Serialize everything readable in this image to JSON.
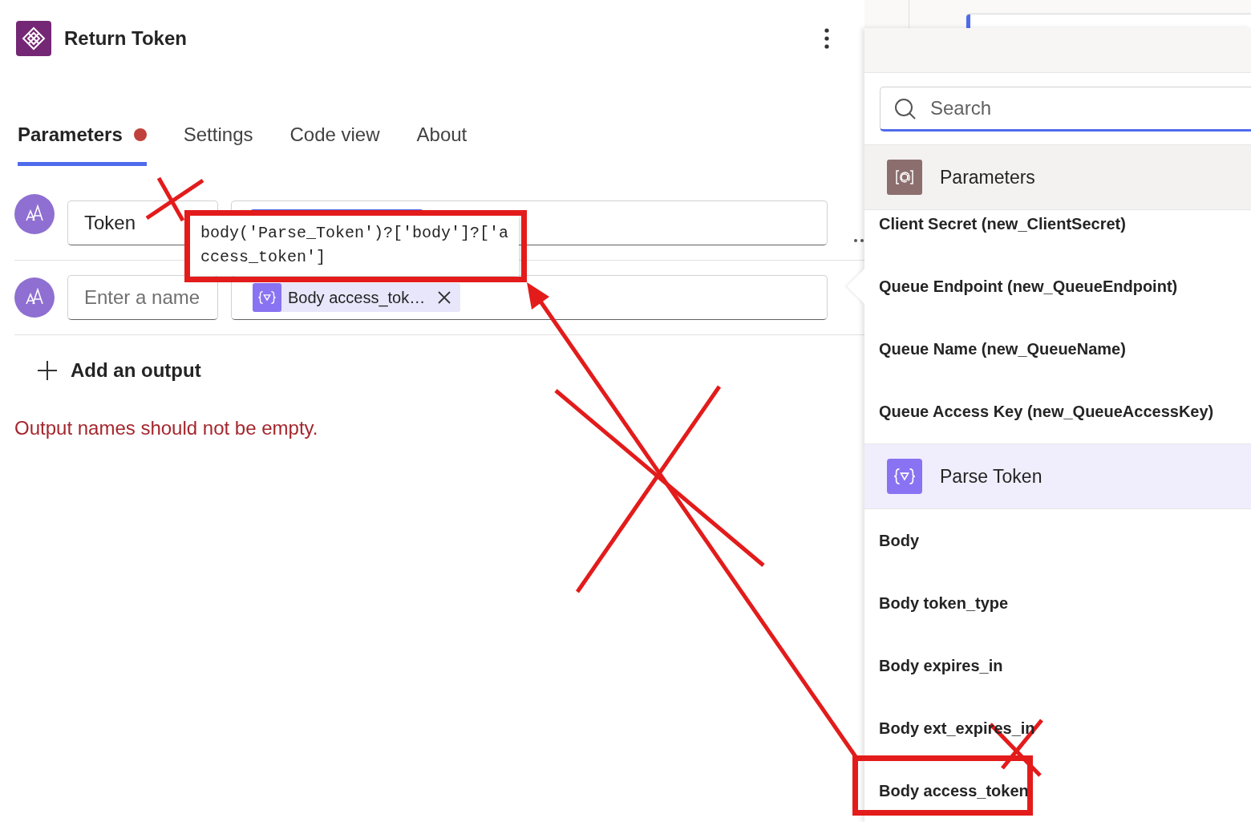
{
  "header": {
    "title": "Return Token"
  },
  "tabs": [
    {
      "label": "Parameters",
      "selected": true,
      "error": true
    },
    {
      "label": "Settings",
      "selected": false,
      "error": false
    },
    {
      "label": "Code view",
      "selected": false,
      "error": false
    },
    {
      "label": "About",
      "selected": false,
      "error": false
    }
  ],
  "outputs": [
    {
      "name": "Token",
      "token": {
        "covered": true
      }
    },
    {
      "placeholder": "Enter a name",
      "token": {
        "label": "Body access_tok…"
      }
    }
  ],
  "tooltip": {
    "text": "body('Parse_Token')?['body']?['access_token']"
  },
  "add_output": {
    "label": "Add an output"
  },
  "error_message": "Output names should not be empty.",
  "picker": {
    "search": {
      "placeholder": "Search"
    },
    "groups": [
      {
        "title": "Parameters",
        "kind": "parameters",
        "items": [
          "Client Secret (new_ClientSecret)",
          "Queue Endpoint (new_QueueEndpoint)",
          "Queue Name (new_QueueName)",
          "Queue Access Key (new_QueueAccessKey)"
        ]
      },
      {
        "title": "Parse Token",
        "kind": "action",
        "items": [
          "Body",
          "Body token_type",
          "Body expires_in",
          "Body ext_expires_in",
          "Body access_token"
        ]
      }
    ]
  }
}
